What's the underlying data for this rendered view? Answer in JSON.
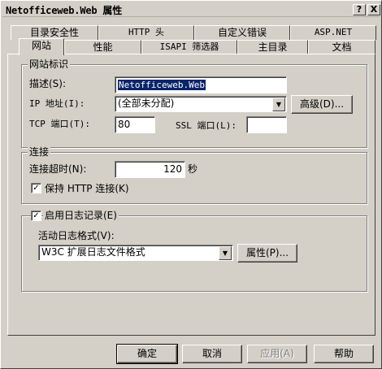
{
  "window": {
    "title": "Netofficeweb.Web 属性",
    "help_btn": "?",
    "close_btn": "X"
  },
  "tabs_row1": [
    "目录安全性",
    "HTTP 头",
    "自定义错误",
    "ASP.NET"
  ],
  "tabs_row2": [
    "网站",
    "性能",
    "ISAPI 筛选器",
    "主目录",
    "文档"
  ],
  "site_id": {
    "group_label": "网站标识",
    "desc_label": "描述(S):",
    "desc_value": "Netofficeweb.Web",
    "ip_label": "IP 地址(I):",
    "ip_value": "(全部未分配)",
    "advanced_btn": "高级(D)...",
    "tcp_label": "TCP 端口(T):",
    "tcp_value": "80",
    "ssl_label": "SSL 端口(L):",
    "ssl_value": ""
  },
  "connection": {
    "group_label": "连接",
    "timeout_label": "连接超时(N):",
    "timeout_value": "120",
    "timeout_unit": "秒",
    "keepalive_label": "保持 HTTP 连接(K)",
    "keepalive_checked": true
  },
  "logging": {
    "enable_label": "启用日志记录(E)",
    "enable_checked": true,
    "format_label": "活动日志格式(V):",
    "format_value": "W3C 扩展日志文件格式",
    "props_btn": "属性(P)..."
  },
  "footer": {
    "ok": "确定",
    "cancel": "取消",
    "apply": "应用(A)",
    "help": "帮助"
  }
}
